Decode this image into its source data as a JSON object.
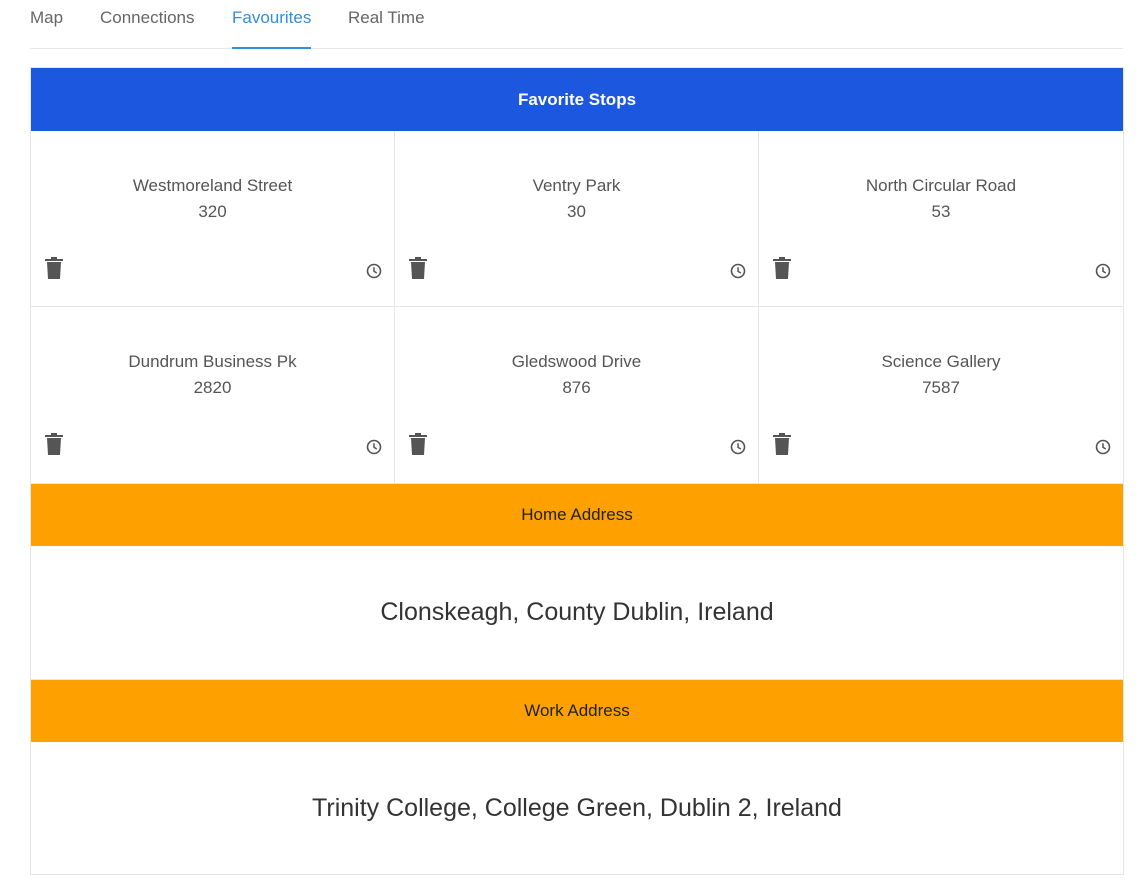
{
  "tabs": [
    {
      "label": "Map"
    },
    {
      "label": "Connections"
    },
    {
      "label": "Favourites",
      "active": true
    },
    {
      "label": "Real Time"
    }
  ],
  "favorites": {
    "title": "Favorite Stops",
    "stops": [
      {
        "name": "Westmoreland Street",
        "code": "320"
      },
      {
        "name": "Ventry Park",
        "code": "30"
      },
      {
        "name": "North Circular Road",
        "code": "53"
      },
      {
        "name": "Dundrum Business Pk",
        "code": "2820"
      },
      {
        "name": "Gledswood Drive",
        "code": "876"
      },
      {
        "name": "Science Gallery",
        "code": "7587"
      }
    ],
    "icons": {
      "delete": "trash-icon",
      "realtime": "clock-icon"
    }
  },
  "home": {
    "title": "Home Address",
    "address": "Clonskeagh, County Dublin, Ireland"
  },
  "work": {
    "title": "Work Address",
    "address": "Trinity College, College Green, Dublin 2, Ireland"
  },
  "colors": {
    "primary": "#1c58df",
    "accent": "#fea100",
    "active_tab": "#2f8fe0"
  }
}
